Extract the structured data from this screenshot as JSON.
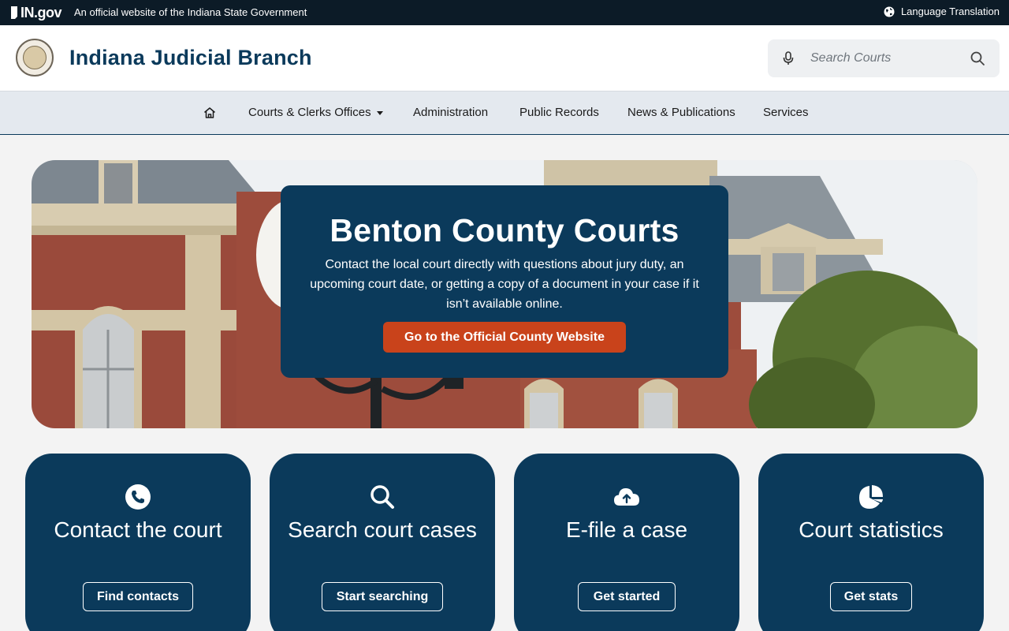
{
  "govbar": {
    "logo_text": "IN.gov",
    "tagline": "An official website of the Indiana State Government",
    "language_label": "Language Translation"
  },
  "header": {
    "site_title": "Indiana Judicial Branch",
    "search_placeholder": "Search Courts"
  },
  "nav": {
    "items": [
      {
        "label": "Courts & Clerks Offices",
        "has_dropdown": true
      },
      {
        "label": "Administration"
      },
      {
        "label": "Public Records"
      },
      {
        "label": "News & Publications"
      },
      {
        "label": "Services"
      }
    ]
  },
  "hero": {
    "title": "Benton County Courts",
    "description": "Contact the local court directly with questions about jury duty, an upcoming court date, or getting a copy of a document in your case if it isn’t available online.",
    "button_label": "Go to the Official County Website"
  },
  "cards": [
    {
      "icon": "phone-icon",
      "title": "Contact the court",
      "button": "Find contacts"
    },
    {
      "icon": "search-icon",
      "title": "Search court cases",
      "button": "Start searching"
    },
    {
      "icon": "cloud-upload-icon",
      "title": "E-file a case",
      "button": "Get started"
    },
    {
      "icon": "pie-chart-icon",
      "title": "Court statistics",
      "button": "Get stats"
    }
  ],
  "colors": {
    "brand_navy": "#0b3a5b",
    "accent_orange": "#c9431b",
    "govbar_bg": "#0c1b27"
  }
}
